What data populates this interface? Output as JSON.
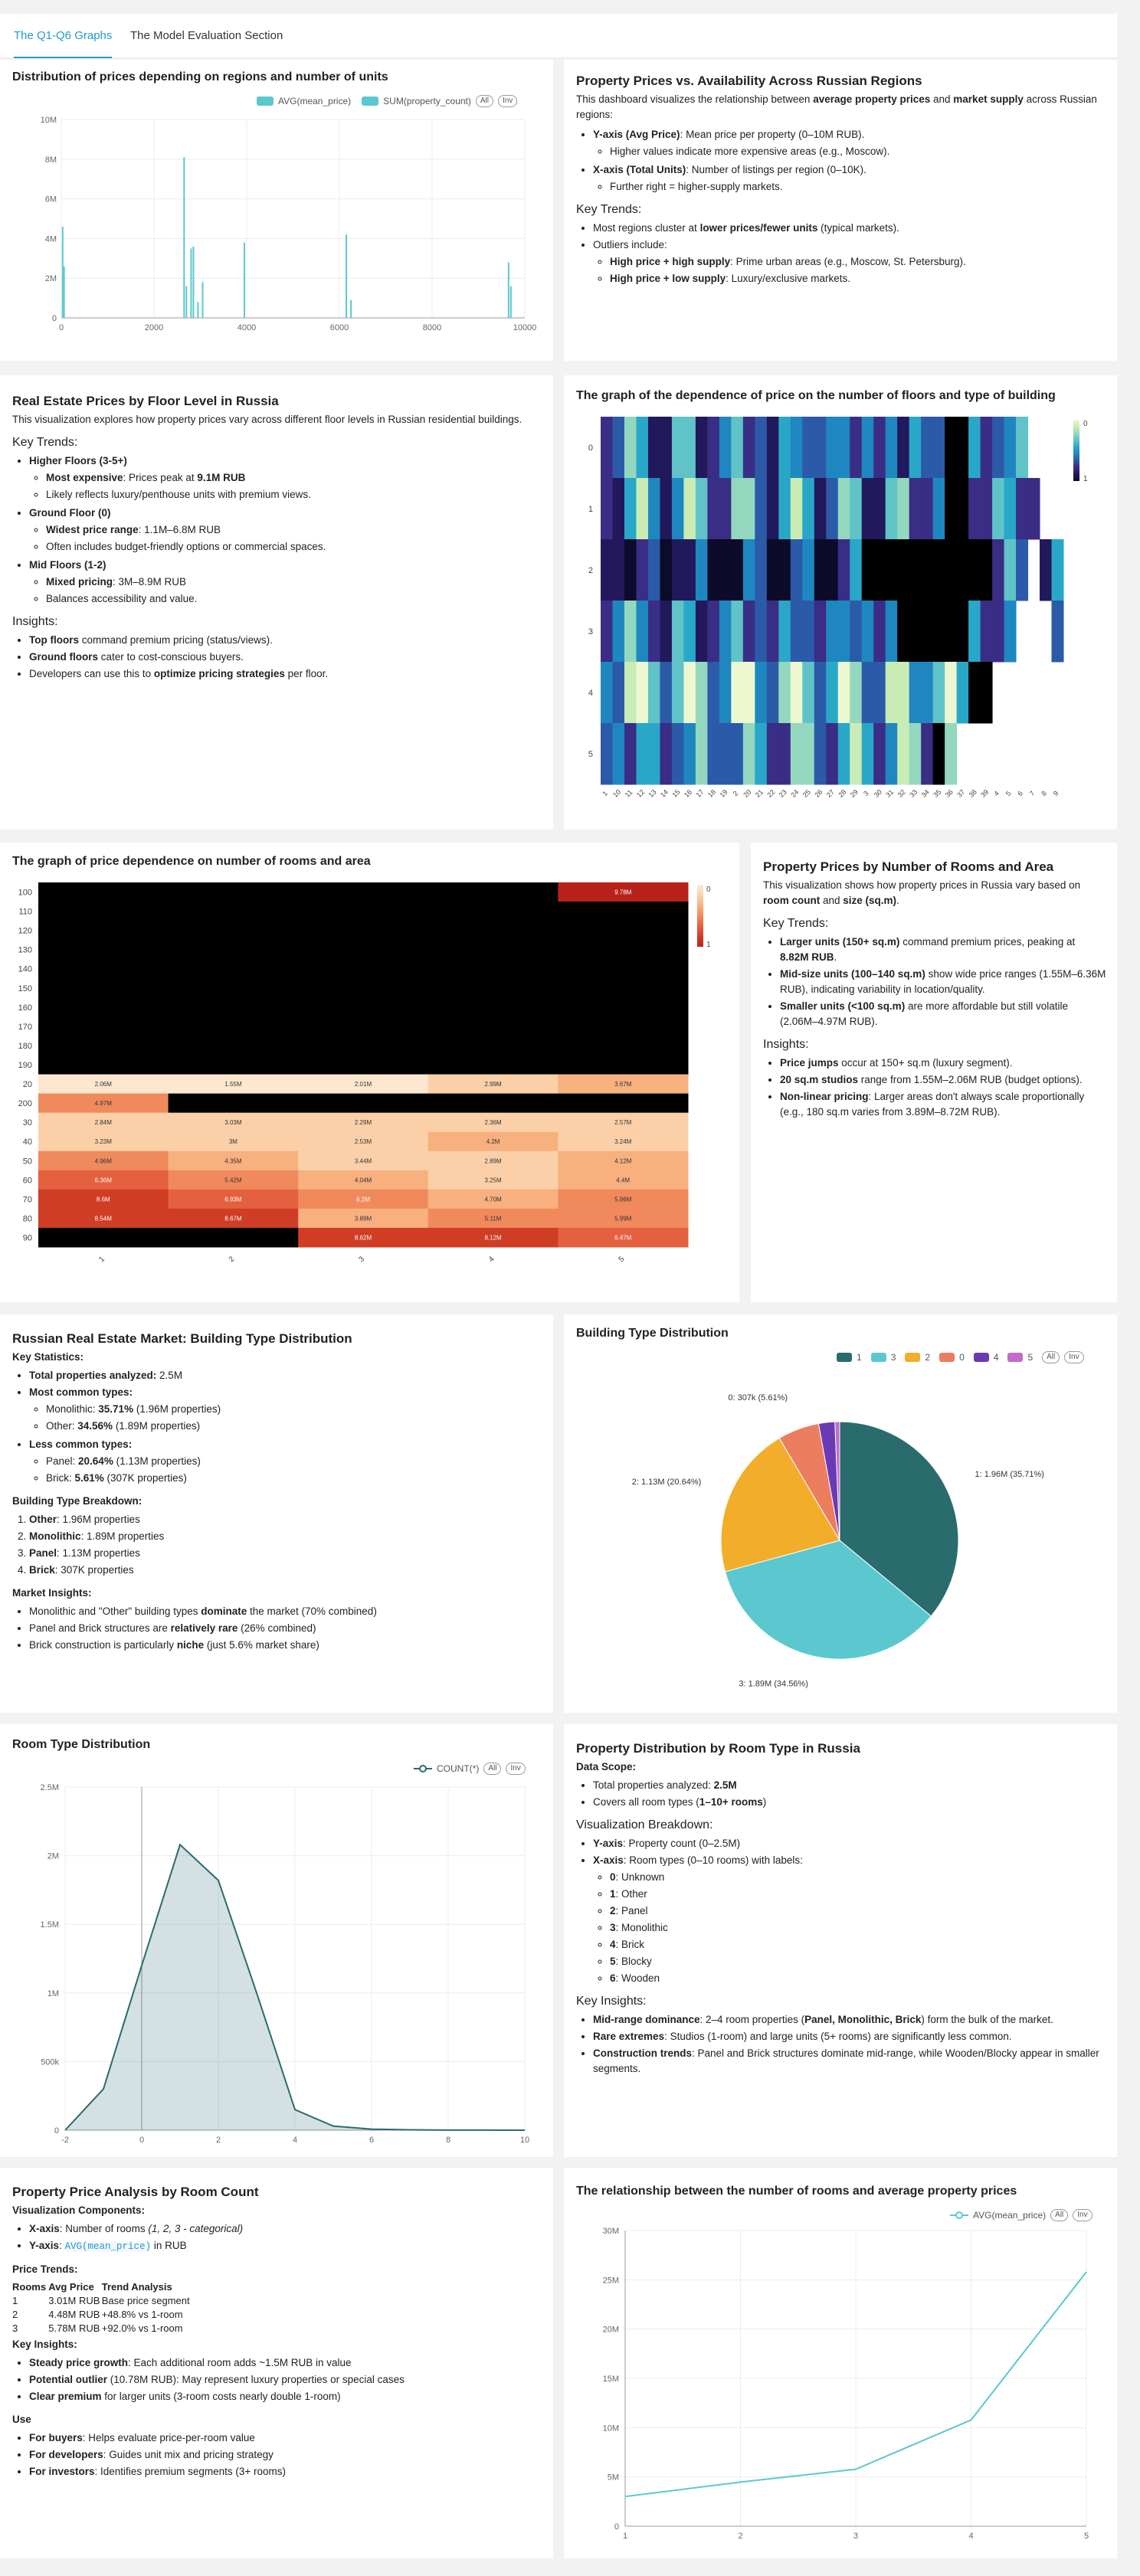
{
  "tabs": [
    "The Q1-Q6 Graphs",
    "The Model Evaluation Section"
  ],
  "colors": {
    "accent": "#1f9bd1",
    "teal": "#5bc8cf",
    "dark_teal": "#2a6b6e"
  },
  "p1": {
    "chart_data": {
      "type": "bar",
      "title": "Distribution of prices depending on regions and number of units",
      "legend": [
        "AVG(mean_price)",
        "SUM(property_count)"
      ],
      "legend_colors": [
        "#5bc8cf",
        "#5bc8cf"
      ],
      "x_ticks": [
        "0",
        "2000",
        "4000",
        "6000",
        "8000",
        "10000"
      ],
      "y_ticks": [
        "0",
        "2M",
        "4M",
        "6M",
        "8M",
        "10M"
      ],
      "xlim": [
        0,
        10000
      ],
      "ylim": [
        0,
        10000000
      ],
      "x": [
        30,
        60,
        2650,
        2700,
        2800,
        2850,
        2950,
        3050,
        3950,
        6150,
        6250,
        9650,
        9700
      ],
      "values": [
        4600000,
        2600000,
        8100000,
        1600000,
        3500000,
        3600000,
        800000,
        1800000,
        3800000,
        4200000,
        900000,
        2800000,
        1600000
      ]
    },
    "buttons": [
      "All",
      "Inv"
    ]
  },
  "p1_text": {
    "title": "Property Prices vs. Availability Across Russian Regions",
    "intro_a": "This dashboard visualizes the relationship between ",
    "intro_b": "average property prices",
    "intro_c": " and ",
    "intro_d": "market supply",
    "intro_e": " across Russian regions:",
    "yaxis_k": "Y-axis (Avg Price)",
    "yaxis_v": ": Mean price per property (0–10M RUB).",
    "yaxis_sub": "Higher values indicate more expensive areas (e.g., Moscow).",
    "xaxis_k": "X-axis (Total Units)",
    "xaxis_v": ": Number of listings per region (0–10K).",
    "xaxis_sub": "Further right = higher-supply markets.",
    "kt": "Key Trends:",
    "kt1_a": "Most regions cluster at ",
    "kt1_b": "lower prices/fewer units",
    "kt1_c": " (typical markets).",
    "kt2": "Outliers include:",
    "o1_k": "High price + high supply",
    "o1_v": ": Prime urban areas (e.g., Moscow, St. Petersburg).",
    "o2_k": "High price + low supply",
    "o2_v": ": Luxury/exclusive markets."
  },
  "p2_text": {
    "title": "Real Estate Prices by Floor Level in Russia",
    "intro": "This visualization explores how property prices vary across different floor levels in Russian residential buildings.",
    "kt": "Key Trends:",
    "h1": "Higher Floors (3-5+)",
    "h1a_k": "Most expensive",
    "h1a_v": ": Prices peak at ",
    "h1a_n": "9.1M RUB",
    "h1b": "Likely reflects luxury/penthouse units with premium views.",
    "g0": "Ground Floor (0)",
    "g0a_k": "Widest price range",
    "g0a_v": ": 1.1M–6.8M RUB",
    "g0b": "Often includes budget-friendly options or commercial spaces.",
    "m1": "Mid Floors (1-2)",
    "m1a_k": "Mixed pricing",
    "m1a_v": ": 3M–8.9M RUB",
    "m1b": "Balances accessibility and value.",
    "ins": "Insights:",
    "i1_k": "Top floors",
    "i1_v": " command premium pricing (status/views).",
    "i2_k": "Ground floors",
    "i2_v": " cater to cost-conscious buyers.",
    "i3_a": "Developers can use this to ",
    "i3_b": "optimize pricing strategies",
    "i3_c": " per floor."
  },
  "p2": {
    "chart_data": {
      "type": "heatmap",
      "title": "The graph of the dependence of price on the number of floors and type of building",
      "rows": [
        "0",
        "1",
        "2",
        "3",
        "4",
        "5"
      ],
      "cols": [
        "1",
        "10",
        "11",
        "12",
        "13",
        "14",
        "15",
        "16",
        "17",
        "18",
        "19",
        "2",
        "20",
        "21",
        "22",
        "23",
        "24",
        "25",
        "26",
        "27",
        "28",
        "29",
        "3",
        "30",
        "31",
        "32",
        "33",
        "34",
        "35",
        "36",
        "37",
        "38",
        "39",
        "4",
        "5",
        "6",
        "7",
        "8",
        "9"
      ],
      "scale_labels": [
        "0",
        "1"
      ]
    }
  },
  "p3": {
    "chart_data": {
      "type": "heatmap",
      "title": "The graph of price dependence on number of rooms and area",
      "rows": [
        "100",
        "110",
        "120",
        "130",
        "140",
        "150",
        "160",
        "170",
        "180",
        "190",
        "20",
        "200",
        "30",
        "40",
        "50",
        "60",
        "70",
        "80",
        "90"
      ],
      "cols": [
        "1",
        "2",
        "3",
        "4",
        "5"
      ],
      "cells": [
        [
          "",
          "",
          "",
          "",
          "9.78M"
        ],
        [
          "",
          "",
          "",
          "",
          ""
        ],
        [
          "",
          "",
          "",
          "",
          ""
        ],
        [
          "",
          "",
          "",
          "",
          ""
        ],
        [
          "",
          "",
          "",
          "",
          ""
        ],
        [
          "",
          "",
          "",
          "",
          ""
        ],
        [
          "",
          "",
          "",
          "",
          ""
        ],
        [
          "",
          "",
          "",
          "",
          ""
        ],
        [
          "",
          "",
          "",
          "",
          ""
        ],
        [
          "",
          "",
          "",
          "",
          ""
        ],
        [
          "2.06M",
          "1.55M",
          "2.01M",
          "2.99M",
          "3.67M"
        ],
        [
          "4.97M",
          "",
          "",
          "",
          ""
        ],
        [
          "2.84M",
          "3.03M",
          "2.29M",
          "2.36M",
          "2.57M"
        ],
        [
          "3.23M",
          "3M",
          "2.53M",
          "4.2M",
          "3.24M"
        ],
        [
          "4.96M",
          "4.35M",
          "3.44M",
          "2.89M",
          "4.12M"
        ],
        [
          "6.36M",
          "5.42M",
          "4.04M",
          "3.25M",
          "4.4M"
        ],
        [
          "8.6M",
          "6.93M",
          "6.2M",
          "4.70M",
          "5.96M"
        ],
        [
          "8.54M",
          "8.67M",
          "3.89M",
          "5.11M",
          "5.99M"
        ],
        [
          "",
          "",
          "8.62M",
          "8.12M",
          "6.47M"
        ]
      ],
      "scale_labels": [
        "0",
        "1"
      ]
    }
  },
  "p3_text": {
    "title": "Property Prices by Number of Rooms and Area",
    "intro_a": "This visualization shows how property prices in Russia vary based on ",
    "intro_b": "room count",
    "intro_c": " and ",
    "intro_d": "size (sq.m)",
    "intro_e": ".",
    "kt": "Key Trends:",
    "t1_k": "Larger units (150+ sq.m)",
    "t1_v": " command premium prices, peaking at ",
    "t1_n": "8.82M RUB",
    "t1_e": ".",
    "t2_k": "Mid-size units (100–140 sq.m)",
    "t2_v": " show wide price ranges (1.55M–6.36M RUB), indicating variability in location/quality.",
    "t3_k": "Smaller units (<100 sq.m)",
    "t3_v": " are more affordable but still volatile (2.06M–4.97M RUB).",
    "ins": "Insights:",
    "i1_k": "Price jumps",
    "i1_v": " occur at 150+ sq.m (luxury segment).",
    "i2_k": "20 sq.m studios",
    "i2_v": " range from 1.55M–2.06M RUB (budget options).",
    "i3_k": "Non-linear pricing",
    "i3_v": ": Larger areas don't always scale proportionally (e.g., 180 sq.m varies from 3.89M–8.72M RUB)."
  },
  "p4_text": {
    "title": "Russian Real Estate Market: Building Type Distribution",
    "ks": "Key Statistics:",
    "s1_k": "Total properties analyzed:",
    "s1_v": " 2.5M",
    "s2_k": "Most common types:",
    "s2a_a": "Monolithic: ",
    "s2a_b": "35.71%",
    "s2a_c": " (1.96M properties)",
    "s2b_a": "Other: ",
    "s2b_b": "34.56%",
    "s2b_c": " (1.89M properties)",
    "s3_k": "Less common types:",
    "s3a_a": "Panel: ",
    "s3a_b": "20.64%",
    "s3a_c": " (1.13M properties)",
    "s3b_a": "Brick: ",
    "s3b_b": "5.61%",
    "s3b_c": " (307K properties)",
    "bt": "Building Type Breakdown:",
    "b1_k": "Other",
    "b1_v": ": 1.96M properties",
    "b2_k": "Monolithic",
    "b2_v": ": 1.89M properties",
    "b3_k": "Panel",
    "b3_v": ": 1.13M properties",
    "b4_k": "Brick",
    "b4_v": ": 307K properties",
    "mi": "Market Insights:",
    "m1_a": "Monolithic and \"Other\" building types ",
    "m1_b": "dominate",
    "m1_c": " the market (70% combined)",
    "m2_a": "Panel and Brick structures are ",
    "m2_b": "relatively rare",
    "m2_c": " (26% combined)",
    "m3_a": "Brick construction is particularly ",
    "m3_b": "niche",
    "m3_c": " (just 5.6% market share)"
  },
  "p4": {
    "chart_data": {
      "type": "pie",
      "title": "Building Type Distribution",
      "legend": [
        "1",
        "3",
        "2",
        "0",
        "4",
        "5"
      ],
      "colors": [
        "#2a6b6e",
        "#5bc8cf",
        "#f2ae2a",
        "#ec7d5e",
        "#6a3ab5",
        "#c36bc9"
      ],
      "slices": [
        {
          "name": "1",
          "value": 1960000,
          "label": "1: 1.96M (35.71%)"
        },
        {
          "name": "3",
          "value": 1890000,
          "label": "3: 1.89M (34.56%)"
        },
        {
          "name": "2",
          "value": 1130000,
          "label": "2: 1.13M (20.64%)"
        },
        {
          "name": "0",
          "value": 307000,
          "label": "0: 307k (5.61%)"
        },
        {
          "name": "4",
          "value": 120000,
          "label": ""
        },
        {
          "name": "5",
          "value": 35000,
          "label": ""
        }
      ]
    },
    "buttons": [
      "All",
      "Inv"
    ]
  },
  "p5": {
    "chart_data": {
      "type": "area",
      "title": "Room Type Distribution",
      "legend": [
        "COUNT(*)"
      ],
      "x": [
        -2,
        -1,
        0,
        1,
        2,
        3,
        4,
        5,
        6,
        7,
        8,
        9,
        10
      ],
      "values": [
        0,
        300000,
        1200000,
        2080000,
        1820000,
        1000000,
        150000,
        30000,
        8000,
        3000,
        1000,
        500,
        200
      ],
      "xlim": [
        -2,
        10
      ],
      "ylim": [
        0,
        2500000
      ],
      "x_ticks": [
        "-2",
        "0",
        "2",
        "4",
        "6",
        "8",
        "10"
      ],
      "y_ticks": [
        "0",
        "500k",
        "1M",
        "1.5M",
        "2M",
        "2.5M"
      ]
    },
    "buttons": [
      "All",
      "Inv"
    ]
  },
  "p5_text": {
    "title": "Property Distribution by Room Type in Russia",
    "ds": "Data Scope:",
    "d1_a": "Total properties analyzed: ",
    "d1_b": "2.5M",
    "d2_a": "Covers all room types (",
    "d2_b": "1–10+ rooms",
    "d2_c": ")",
    "vb": "Visualization Breakdown:",
    "y_k": "Y-axis",
    "y_v": ": Property count (0–2.5M)",
    "x_k": "X-axis",
    "x_v": ": Room types (0–10 rooms) with labels:",
    "labels": [
      [
        "0",
        "Unknown"
      ],
      [
        "1",
        "Other"
      ],
      [
        "2",
        "Panel"
      ],
      [
        "3",
        "Monolithic"
      ],
      [
        "4",
        "Brick"
      ],
      [
        "5",
        "Blocky"
      ],
      [
        "6",
        "Wooden"
      ]
    ],
    "ki": "Key Insights:",
    "k1_k": "Mid-range dominance",
    "k1_v": ": 2–4 room properties (",
    "k1_b": "Panel, Monolithic, Brick",
    "k1_c": ") form the bulk of the market.",
    "k2_k": "Rare extremes",
    "k2_v": ": Studios (1-room) and large units (5+ rooms) are significantly less common.",
    "k3_k": "Construction trends",
    "k3_v": ": Panel and Brick structures dominate mid-range, while Wooden/Blocky appear in smaller segments."
  },
  "p6_text": {
    "title": "Property Price Analysis by Room Count",
    "vc": "Visualization Components:",
    "x_k": "X-axis",
    "x_v": ": Number of rooms ",
    "x_i": "(1, 2, 3 - categorical)",
    "y_k": "Y-axis",
    "y_v": ": ",
    "y_code": "AVG(mean_price)",
    "y_e": " in RUB",
    "pt": "Price Trends:",
    "th": [
      "Rooms",
      "Avg Price",
      "Trend Analysis"
    ],
    "rows": [
      [
        "1",
        "3.01M RUB",
        "Base price segment"
      ],
      [
        "2",
        "4.48M RUB",
        "+48.8% vs 1-room"
      ],
      [
        "3",
        "5.78M RUB",
        "+92.0% vs 1-room"
      ]
    ],
    "ki": "Key Insights:",
    "k1_k": "Steady price growth",
    "k1_v": ": Each additional room adds ~1.5M RUB in value",
    "k2_k": "Potential outlier",
    "k2_v": " (10.78M RUB): May represent luxury properties or special cases",
    "k3_k": "Clear premium",
    "k3_v": " for larger units (3-room costs nearly double 1-room)",
    "use": "Use",
    "u1_k": "For buyers",
    "u1_v": ": Helps evaluate price-per-room value",
    "u2_k": "For developers",
    "u2_v": ": Guides unit mix and pricing strategy",
    "u3_k": "For investors",
    "u3_v": ": Identifies premium segments (3+ rooms)"
  },
  "p6": {
    "chart_data": {
      "type": "line",
      "title": "The relationship between the number of rooms and average property prices",
      "legend": [
        "AVG(mean_price)"
      ],
      "x": [
        1,
        2,
        3,
        4,
        5
      ],
      "values": [
        3010000,
        4480000,
        5780000,
        10780000,
        25800000
      ],
      "xlim": [
        1,
        5
      ],
      "ylim": [
        0,
        30000000
      ],
      "x_ticks": [
        "1",
        "2",
        "3",
        "4",
        "5"
      ],
      "y_ticks": [
        "0",
        "5M",
        "10M",
        "15M",
        "20M",
        "25M",
        "30M"
      ]
    },
    "buttons": [
      "All",
      "Inv"
    ]
  }
}
